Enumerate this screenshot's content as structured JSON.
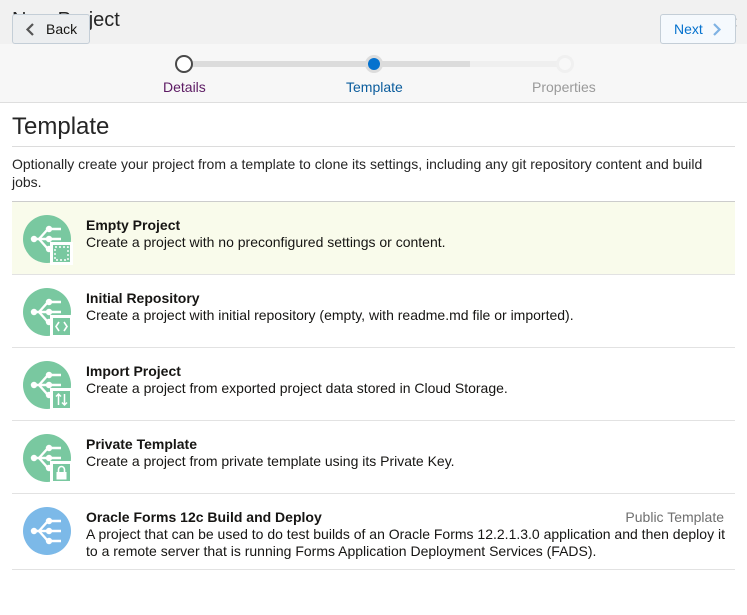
{
  "dialog": {
    "title": "New Project",
    "close_symbol": "×"
  },
  "nav": {
    "back_label": "Back",
    "next_label": "Next",
    "steps": [
      {
        "label": "Details",
        "state": "visited"
      },
      {
        "label": "Template",
        "state": "current"
      },
      {
        "label": "Properties",
        "state": "disabled"
      }
    ]
  },
  "page": {
    "title": "Template",
    "intro": "Optionally create your project from a template to clone its settings, including any git repository content and build jobs."
  },
  "templates": [
    {
      "name": "Empty Project",
      "description": "Create a project with no preconfigured settings or content.",
      "badge": "",
      "icon": "empty-project-icon",
      "selected": true
    },
    {
      "name": "Initial Repository",
      "description": "Create a project with initial repository (empty, with readme.md file or imported).",
      "badge": "",
      "icon": "code-repository-icon",
      "selected": false
    },
    {
      "name": "Import Project",
      "description": "Create a project from exported project data stored in Cloud Storage.",
      "badge": "",
      "icon": "import-icon",
      "selected": false
    },
    {
      "name": "Private Template",
      "description": "Create a project from private template using its Private Key.",
      "badge": "",
      "icon": "lock-icon",
      "selected": false
    },
    {
      "name": "Oracle Forms 12c Build and Deploy",
      "description": "A project that can be used to do test builds of an Oracle Forms 12.2.1.3.0 application and then deploy it to a remote server that is running Forms Application Deployment Services (FADS).",
      "badge": "Public Template",
      "icon": "public-template-icon",
      "selected": false
    }
  ],
  "colors": {
    "accent": "#0572ce",
    "selected_row": "#f9fbeb",
    "icon_green": "#79c8a0",
    "icon_blue": "#7cb9e8"
  }
}
